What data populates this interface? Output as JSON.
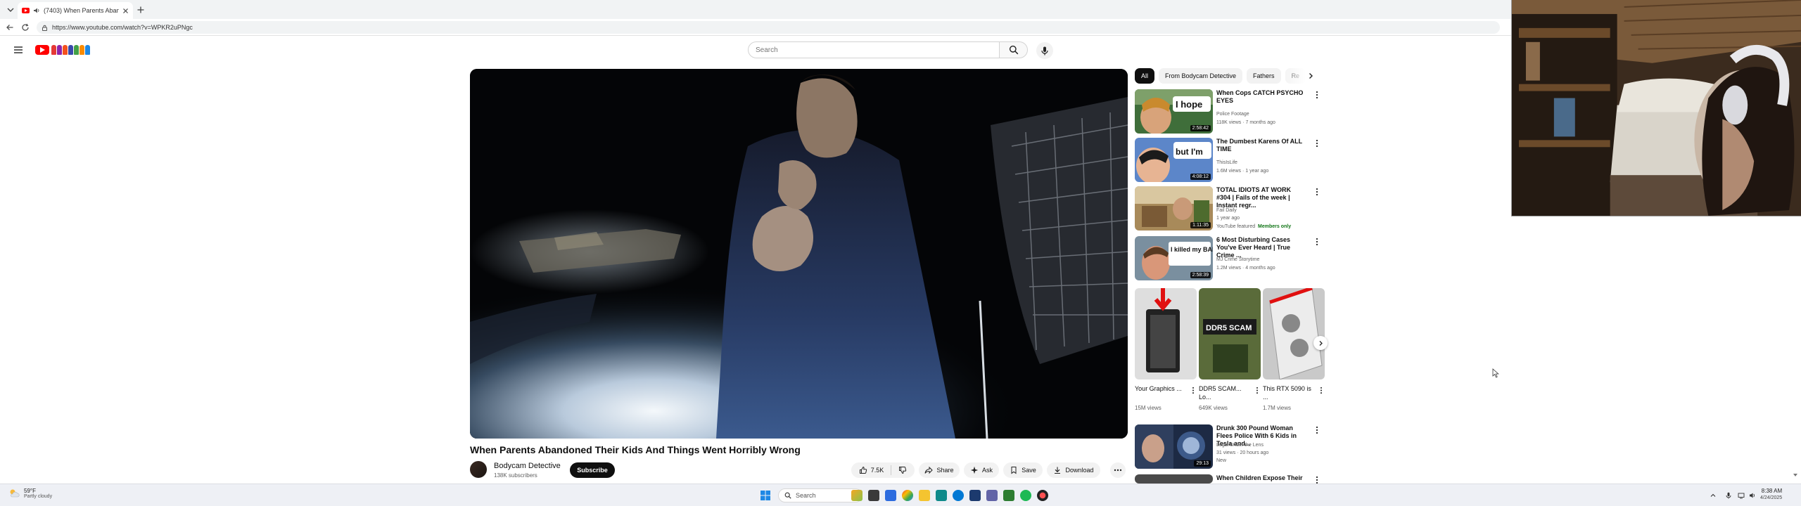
{
  "browser": {
    "tab_title": "(7403) When Parents Abando...",
    "url": "https://www.youtube.com/watch?v=WPKR2uPNgc"
  },
  "masthead": {
    "search_placeholder": "Search"
  },
  "video": {
    "title": "When Parents Abandoned Their Kids And Things Went Horribly Wrong",
    "channel": "Bodycam Detective",
    "subscribers": "138K subscribers",
    "subscribe_label": "Subscribe",
    "likes": "7.5K",
    "share_label": "Share",
    "ask_label": "Ask",
    "save_label": "Save",
    "download_label": "Download"
  },
  "chips": [
    "All",
    "From Bodycam Detective",
    "Fathers",
    "Re"
  ],
  "recommendations": [
    {
      "title": "When Cops CATCH PSYCHO EYES",
      "channel": "Police Footage",
      "meta": "118K views · 7 months ago",
      "duration": "2:58:42",
      "thumb_text": "I hope"
    },
    {
      "title": "The Dumbest Karens Of ALL TIME",
      "channel": "ThisIsLife",
      "meta": "1.6M views · 1 year ago",
      "duration": "4:08:12",
      "thumb_text": "but I'm"
    },
    {
      "title": "TOTAL IDIOTS AT WORK #304 | Fails of the week | Instant regr...",
      "channel": "Fail Daily",
      "meta": "1 year ago",
      "duration": "1:11:35",
      "badge_featured": "YouTube featured",
      "badge_members": "Members only"
    },
    {
      "title": "6 Most Disturbing Cases You've Ever Heard | True Crime ...",
      "channel": "MJ Crime Storytime",
      "meta": "1.2M views · 4 months ago",
      "duration": "2:58:39",
      "thumb_text": "I killed my BABIES"
    }
  ],
  "shorts": [
    {
      "title": "Your Graphics ...",
      "views": "15M views"
    },
    {
      "title": "DDR5 SCAM... Lo...",
      "views": "649K views",
      "thumb_text": "DDR5 SCAM"
    },
    {
      "title": "This RTX 5090 is ...",
      "views": "1.7M views"
    }
  ],
  "recommendations_more": [
    {
      "title": "Drunk 300 Pound Woman Flees Police With 6 Kids in Tesla and...",
      "channel": "Legal Under the Lens",
      "meta": "31 views · 20 hours ago",
      "extra": "New",
      "duration": "29:13"
    },
    {
      "title": "When Children Expose Their"
    }
  ],
  "taskbar": {
    "weather_temp": "59°F",
    "weather_desc": "Partly cloudy",
    "search_label": "Search",
    "time": "8:38 AM",
    "date": "4/24/2025"
  },
  "colors": {
    "youtube_red": "#ff0000",
    "text_primary": "#0f0f0f",
    "text_secondary": "#606060",
    "members_green": "#107516"
  }
}
